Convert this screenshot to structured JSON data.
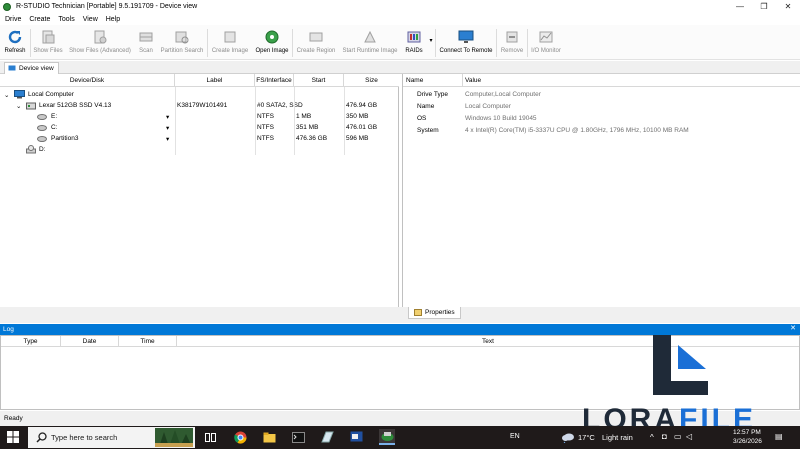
{
  "window": {
    "title": "R-STUDIO Technician [Portable] 9.5.191709 - Device view",
    "controls": [
      "—",
      "❐",
      "✕"
    ]
  },
  "menu": [
    "Drive",
    "Create",
    "Tools",
    "View",
    "Help"
  ],
  "toolbar": {
    "refresh": "Refresh",
    "show_files": "Show Files",
    "show_files_adv": "Show Files (Advanced)",
    "scan": "Scan",
    "partition_search": "Partition Search",
    "create_image": "Create Image",
    "open_image": "Open Image",
    "create_region": "Create Region",
    "start_runtime_image": "Start Runtime Image",
    "raids": "RAIDs",
    "connect_remote": "Connect To Remote",
    "remove": "Remove",
    "io_monitor": "I/O Monitor"
  },
  "tabs": {
    "device_view": "Device view",
    "properties": "Properties"
  },
  "device_table": {
    "columns": [
      "Device/Disk",
      "Label",
      "FS/Interface",
      "Start",
      "Size"
    ],
    "rows": [
      {
        "name": "Local Computer",
        "label": "",
        "fs": "",
        "start": "",
        "size": ""
      },
      {
        "name": "Lexar 512GB SSD V4.13",
        "label": "K38179W101491",
        "fs": "#0 SATA2, SSD",
        "start": "",
        "size": "476.94 GB"
      },
      {
        "name": "E:",
        "label": "",
        "fs": "NTFS",
        "start": "1 MB",
        "size": "350 MB"
      },
      {
        "name": "C:",
        "label": "",
        "fs": "NTFS",
        "start": "351 MB",
        "size": "476.01 GB"
      },
      {
        "name": "Partition3",
        "label": "",
        "fs": "NTFS",
        "start": "476.36 GB",
        "size": "596 MB"
      },
      {
        "name": "D:",
        "label": "",
        "fs": "",
        "start": "",
        "size": ""
      }
    ]
  },
  "properties": {
    "columns": [
      "Name",
      "Value"
    ],
    "rows": [
      {
        "name": "Drive Type",
        "value": "Computer,Local Computer"
      },
      {
        "name": "Name",
        "value": "Local Computer"
      },
      {
        "name": "OS",
        "value": "Windows 10 Build 19045"
      },
      {
        "name": "System",
        "value": "4 x Intel(R) Core(TM) i5-3337U CPU @ 1.80GHz, 1796 MHz, 10100 MB RAM"
      }
    ]
  },
  "log": {
    "title": "Log",
    "columns": [
      "Type",
      "Date",
      "Time",
      "Text"
    ]
  },
  "status": "Ready",
  "taskbar": {
    "search_placeholder": "Type here to search",
    "lang": "EN",
    "weather_temp": "17°C",
    "weather_desc": "Light rain",
    "time": "12:57 PM",
    "date": "3/26/2026"
  },
  "watermark": {
    "brand": "LORAFILE",
    "color_dark": "#1f2a38",
    "color_blue": "#1a6fd6"
  },
  "colors": {
    "accent": "#0078d7"
  }
}
